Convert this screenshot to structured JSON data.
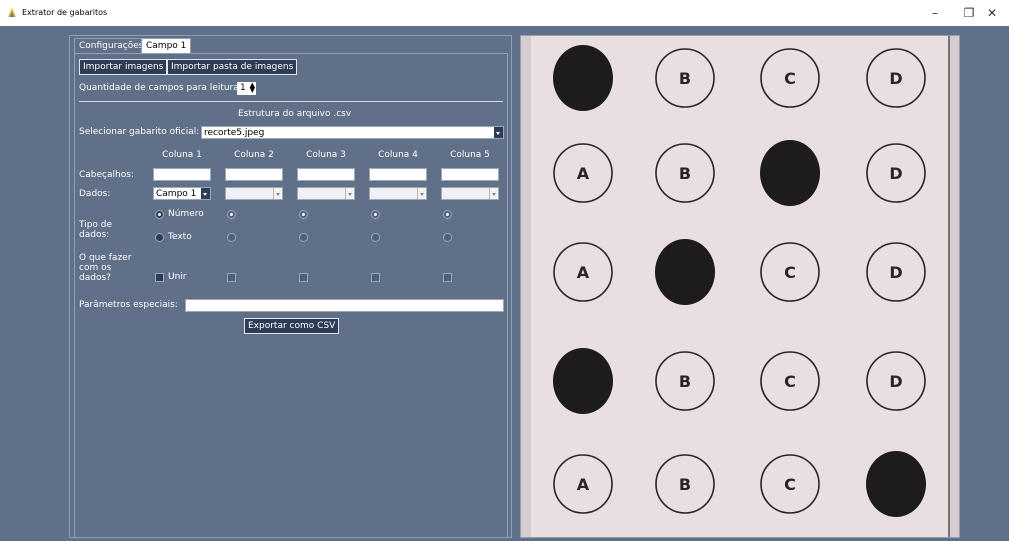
{
  "window": {
    "title": "Extrator de gabaritos",
    "controls": [
      "–",
      "❐",
      "✕"
    ]
  },
  "tabs": [
    {
      "label": "Configurações",
      "active": false
    },
    {
      "label": "Campo 1",
      "active": true
    }
  ],
  "toolbar": {
    "import_images": "Importar imagens",
    "import_folder": "Importar pasta de imagens"
  },
  "fields_count": {
    "label": "Quantidade de campos para leitura:",
    "value": "1"
  },
  "csv": {
    "section_title": "Estrutura do arquivo .csv",
    "official_key_label": "Selecionar gabarito oficial:",
    "official_key_value": "recorte5.jpeg",
    "columns": [
      "Coluna 1",
      "Coluna 2",
      "Coluna 3",
      "Coluna 4",
      "Coluna 5"
    ],
    "row_labels": {
      "headers": "Cabeçalhos:",
      "data": "Dados:",
      "data_type_line1": "Tipo de",
      "data_type_line2": "dados:",
      "action_line1": "O que fazer",
      "action_line2": "com os",
      "action_line3": "dados?"
    },
    "col1": {
      "data_value": "Campo 1",
      "type_number": "Número",
      "type_text": "Texto",
      "action_merge": "Unir"
    },
    "special_params_label": "Parâmetros especiais:",
    "export_button": "Exportar como CSV"
  },
  "answer_sheet": {
    "rows": [
      {
        "options": [
          "A",
          "B",
          "C",
          "D"
        ],
        "marked": "A"
      },
      {
        "options": [
          "A",
          "B",
          "C",
          "D"
        ],
        "marked": "C"
      },
      {
        "options": [
          "A",
          "B",
          "C",
          "D"
        ],
        "marked": "B"
      },
      {
        "options": [
          "A",
          "B",
          "C",
          "D"
        ],
        "marked": "A"
      },
      {
        "options": [
          "A",
          "B",
          "C",
          "D"
        ],
        "marked": "D"
      }
    ],
    "colors": {
      "paper": "#e9dfe1",
      "ink": "#2a2526",
      "mark": "#1d1b1c"
    }
  }
}
